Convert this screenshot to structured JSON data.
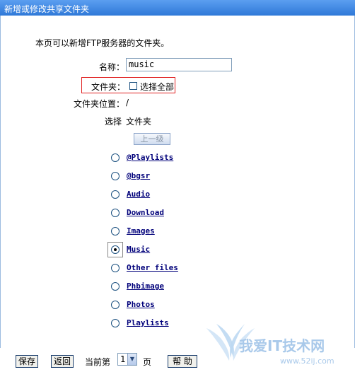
{
  "window": {
    "title": "新增或修改共享文件夹"
  },
  "intro": "本页可以新增FTP服务器的文件夹。",
  "form": {
    "name_label": "名称：",
    "name_value": "music",
    "folder_label": "文件夹：",
    "select_all_label": "选择全部",
    "location_label": "文件夹位置：",
    "location_value": "/",
    "col_select": "选择",
    "col_folder": "文件夹",
    "up_button": "上一级"
  },
  "folders": [
    {
      "name": "@Playlists",
      "selected": false
    },
    {
      "name": "@bgsr",
      "selected": false
    },
    {
      "name": "Audio",
      "selected": false
    },
    {
      "name": "Download",
      "selected": false
    },
    {
      "name": "Images",
      "selected": false
    },
    {
      "name": "Music",
      "selected": true
    },
    {
      "name": "Other files",
      "selected": false
    },
    {
      "name": "Phbimage",
      "selected": false
    },
    {
      "name": "Photos",
      "selected": false
    },
    {
      "name": "Playlists",
      "selected": false
    }
  ],
  "footer": {
    "save": "保存",
    "back": "返回",
    "current_page_label": "当前第",
    "page_value": "1",
    "page_suffix": "页",
    "help": "帮 助"
  },
  "watermark": {
    "text": "我爱IT技术网",
    "url": "www.52ij.com"
  },
  "colors": {
    "titlebar": "#2f79d8",
    "highlight_box": "#e02020",
    "link": "#00007a"
  }
}
